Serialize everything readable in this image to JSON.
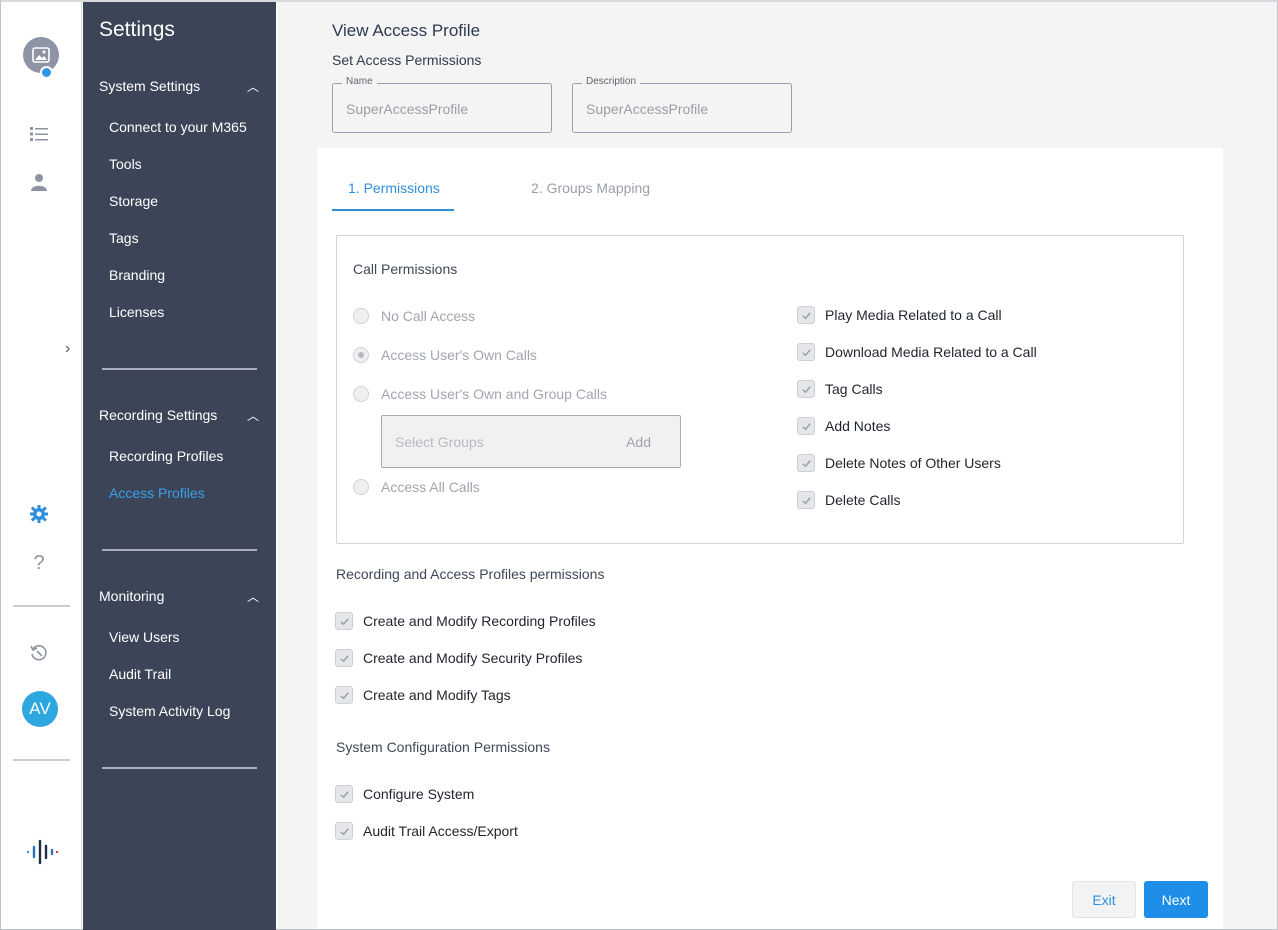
{
  "sidebar": {
    "title": "Settings",
    "sections": [
      {
        "label": "System Settings",
        "items": [
          "Connect to your M365",
          "Tools",
          "Storage",
          "Tags",
          "Branding",
          "Licenses"
        ]
      },
      {
        "label": "Recording Settings",
        "items": [
          "Recording Profiles",
          "Access Profiles"
        ]
      },
      {
        "label": "Monitoring",
        "items": [
          "View Users",
          "Audit Trail",
          "System Activity Log"
        ]
      }
    ],
    "active_item": "Access Profiles"
  },
  "rail": {
    "user_initials": "AV",
    "help_label": "?"
  },
  "page": {
    "title": "View Access Profile",
    "subtitle": "Set Access Permissions",
    "name_label": "Name",
    "name_value": "SuperAccessProfile",
    "description_label": "Description",
    "description_value": "SuperAccessProfile"
  },
  "tabs": [
    {
      "label": "1. Permissions",
      "active": true
    },
    {
      "label": "2. Groups Mapping",
      "active": false
    }
  ],
  "call_permissions": {
    "heading": "Call Permissions",
    "radios": [
      {
        "label": "No Call Access",
        "checked": false
      },
      {
        "label": "Access User's Own Calls",
        "checked": true
      },
      {
        "label": "Access User's Own and Group Calls",
        "checked": false
      },
      {
        "label": "Access All Calls",
        "checked": false
      }
    ],
    "select_groups_placeholder": "Select Groups",
    "add_label": "Add",
    "checkboxes": [
      {
        "label": "Play Media Related to a Call",
        "checked": true
      },
      {
        "label": "Download Media Related to a Call",
        "checked": true
      },
      {
        "label": "Tag Calls",
        "checked": true
      },
      {
        "label": "Add Notes",
        "checked": true
      },
      {
        "label": "Delete Notes of Other Users",
        "checked": true
      },
      {
        "label": "Delete Calls",
        "checked": true
      }
    ]
  },
  "recording_permissions": {
    "heading": "Recording and Access Profiles permissions",
    "checkboxes": [
      {
        "label": "Create and Modify Recording Profiles",
        "checked": true
      },
      {
        "label": "Create and Modify Security Profiles",
        "checked": true
      },
      {
        "label": "Create and Modify Tags",
        "checked": true
      }
    ]
  },
  "system_permissions": {
    "heading": "System Configuration Permissions",
    "checkboxes": [
      {
        "label": "Configure System",
        "checked": true
      },
      {
        "label": "Audit Trail Access/Export",
        "checked": true
      }
    ]
  },
  "buttons": {
    "exit": "Exit",
    "next": "Next"
  },
  "colors": {
    "sidebar_bg": "#3c4558",
    "accent": "#1e8ee8",
    "active_link": "#3aa0ea"
  }
}
